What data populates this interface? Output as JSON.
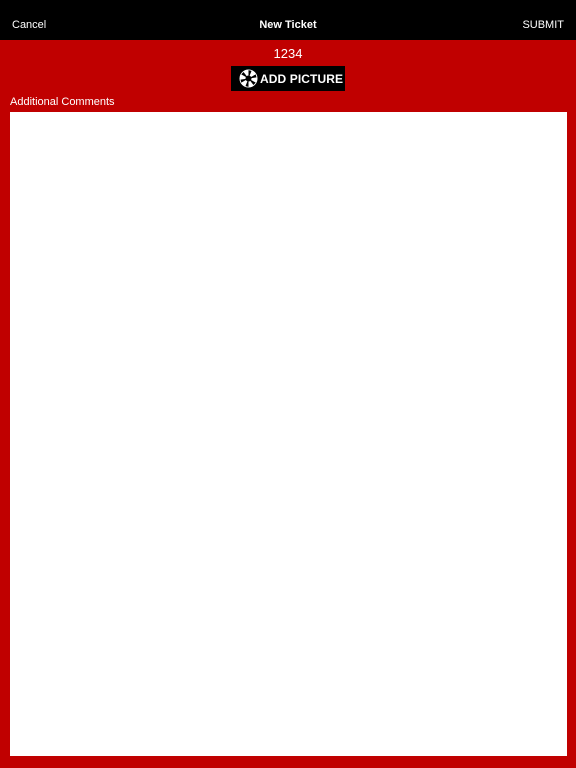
{
  "nav": {
    "cancel_label": "Cancel",
    "title": "New Ticket",
    "submit_label": "SUBMIT"
  },
  "ticket": {
    "number": "1234"
  },
  "add_picture": {
    "label": "ADD PICTURE",
    "icon": "camera-aperture-icon"
  },
  "comments": {
    "label": "Additional Comments",
    "value": ""
  },
  "colors": {
    "nav_background": "#000000",
    "content_background": "#c00000",
    "button_background": "#000000",
    "text": "#ffffff",
    "textarea_background": "#ffffff"
  }
}
